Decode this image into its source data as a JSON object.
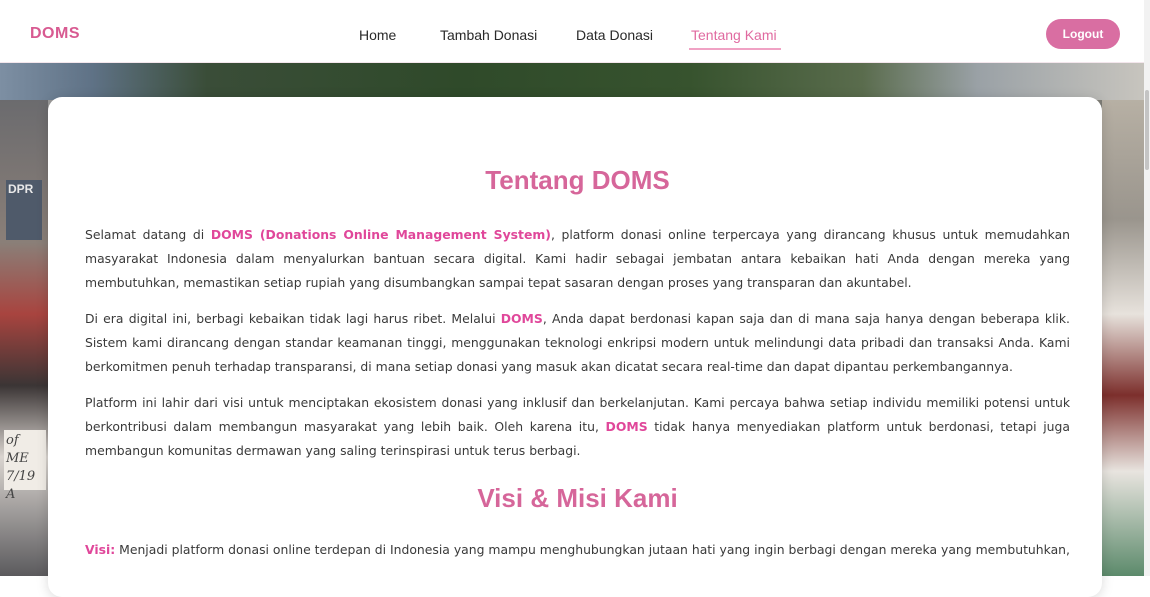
{
  "nav": {
    "brand": "DOMS",
    "links": [
      "Home",
      "Tambah Donasi",
      "Data Donasi",
      "Tentang Kami"
    ],
    "active": "Tentang Kami",
    "logout_label": "Logout"
  },
  "background": {
    "sign_text": "DPR",
    "banner_text": "of ME 7/19 A"
  },
  "main": {
    "title": "Tentang DOMS",
    "p1": {
      "pre": "Selamat datang di ",
      "hl": "DOMS (Donations Online Management System)",
      "post": ", platform donasi online terpercaya yang dirancang khusus untuk memudahkan masyarakat Indonesia dalam menyalurkan bantuan secara digital. Kami hadir sebagai jembatan antara kebaikan hati Anda dengan mereka yang membutuhkan, memastikan setiap rupiah yang disumbangkan sampai tepat sasaran dengan proses yang transparan dan akuntabel."
    },
    "p2": {
      "pre": "Di era digital ini, berbagi kebaikan tidak lagi harus ribet. Melalui ",
      "hl": "DOMS",
      "post": ", Anda dapat berdonasi kapan saja dan di mana saja hanya dengan beberapa klik. Sistem kami dirancang dengan standar keamanan tinggi, menggunakan teknologi enkripsi modern untuk melindungi data pribadi dan transaksi Anda. Kami berkomitmen penuh terhadap transparansi, di mana setiap donasi yang masuk akan dicatat secara real-time dan dapat dipantau perkembangannya."
    },
    "p3": {
      "pre": "Platform ini lahir dari visi untuk menciptakan ekosistem donasi yang inklusif dan berkelanjutan. Kami percaya bahwa setiap individu memiliki potensi untuk berkontribusi dalam membangun masyarakat yang lebih baik. Oleh karena itu, ",
      "hl": "DOMS",
      "post": " tidak hanya menyediakan platform untuk berdonasi, tetapi juga membangun komunitas dermawan yang saling terinspirasi untuk terus berbagi."
    },
    "subtitle": "Visi & Misi Kami",
    "visi": {
      "label": "Visi:",
      "text": " Menjadi platform donasi online terdepan di Indonesia yang mampu menghubungkan jutaan hati yang ingin berbagi dengan mereka yang membutuhkan,"
    }
  },
  "colors": {
    "accent": "#d6669a",
    "highlight": "#e0479a",
    "logout_bg": "#d96ea2"
  }
}
